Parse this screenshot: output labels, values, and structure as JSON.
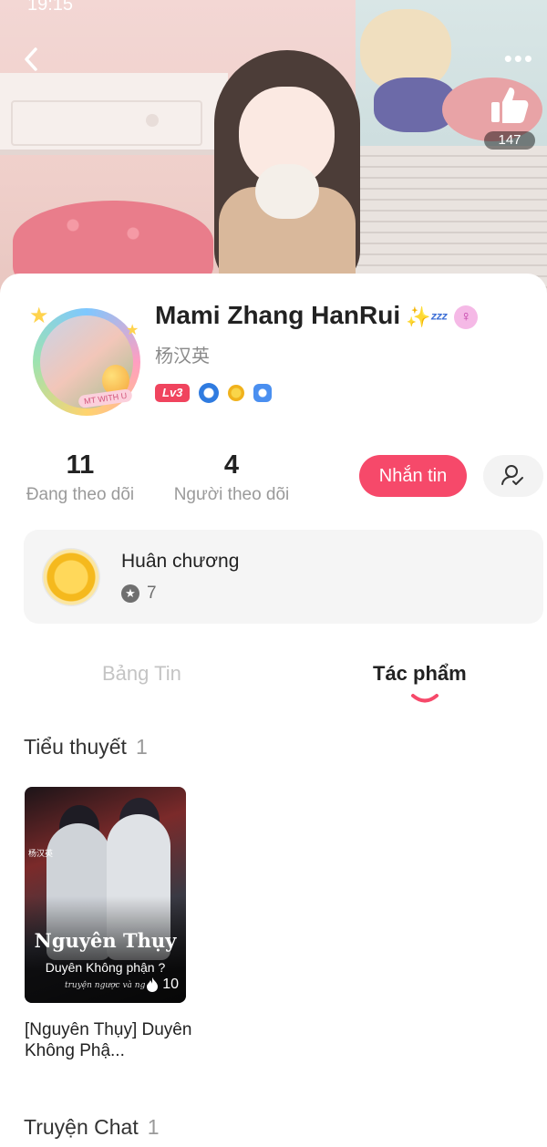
{
  "status_bar": {
    "time": "19:15"
  },
  "header": {
    "like_count": "147"
  },
  "profile": {
    "name": "Mami Zhang HanRui",
    "name_emoji": "✨",
    "sleep_emoji": "ᶻᶻᶻ",
    "subname": "杨汉英",
    "level": "Lv3",
    "avatar_tag": "MT WITH U"
  },
  "stats": {
    "following_count": "11",
    "following_label": "Đang theo dõi",
    "followers_count": "4",
    "followers_label": "Người theo dõi"
  },
  "actions": {
    "message_label": "Nhắn tin"
  },
  "medal": {
    "title": "Huân chương",
    "count": "7"
  },
  "tabs": [
    {
      "label": "Bảng Tin",
      "active": false
    },
    {
      "label": "Tác phẩm",
      "active": true
    }
  ],
  "sections": {
    "novels": {
      "title": "Tiểu thuyết",
      "count": "1",
      "items": [
        {
          "cover_small_text": "杨汉英",
          "cover_title": "Nguyên Thụy",
          "cover_subtitle": "Duyên Không phận ?",
          "cover_tag": "truyện ngược và ng",
          "reads": "10",
          "name": "[Nguyên Thụy] Duyên Không Phậ..."
        }
      ]
    },
    "chat_stories": {
      "title": "Truyện Chat",
      "count": "1"
    }
  },
  "colors": {
    "accent": "#f6496a",
    "level_badge": "#f0445e",
    "tab_active": "#222222",
    "tab_inactive": "#c4c4c4"
  }
}
